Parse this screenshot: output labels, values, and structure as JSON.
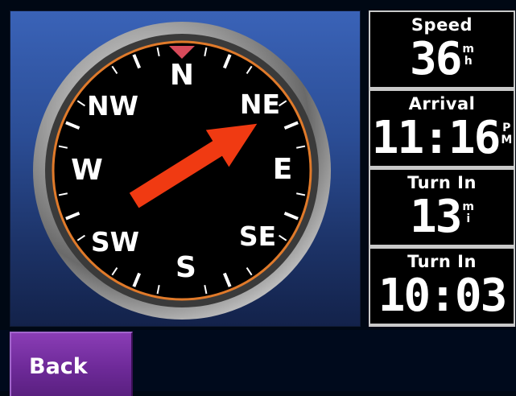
{
  "compass": {
    "cardinals": {
      "N": "N",
      "NE": "NE",
      "E": "E",
      "SE": "SE",
      "S": "S",
      "SW": "SW",
      "W": "W",
      "NW": "NW"
    },
    "heading": "NE",
    "heading_degrees": 58,
    "colors": {
      "dial": "#000000",
      "bezel": "#9a9a9a",
      "ring": "#e07a2a",
      "needle": "#f03a12",
      "north_marker": "#d84a5a"
    }
  },
  "data_fields": [
    {
      "label": "Speed",
      "value": "36",
      "unit_top": "m",
      "unit_bottom": "h"
    },
    {
      "label": "Arrival",
      "value": "11:16",
      "unit_top": "P",
      "unit_bottom": "M"
    },
    {
      "label": "Turn In",
      "value": "13",
      "unit_top": "m",
      "unit_bottom": "i"
    },
    {
      "label": "Turn In",
      "value": "10:03",
      "unit_top": "",
      "unit_bottom": ""
    }
  ],
  "bottom_bar": {
    "back_label": "Back"
  },
  "colors": {
    "panel_blue": "#2b4d95",
    "back_button": "#6e2a99"
  }
}
